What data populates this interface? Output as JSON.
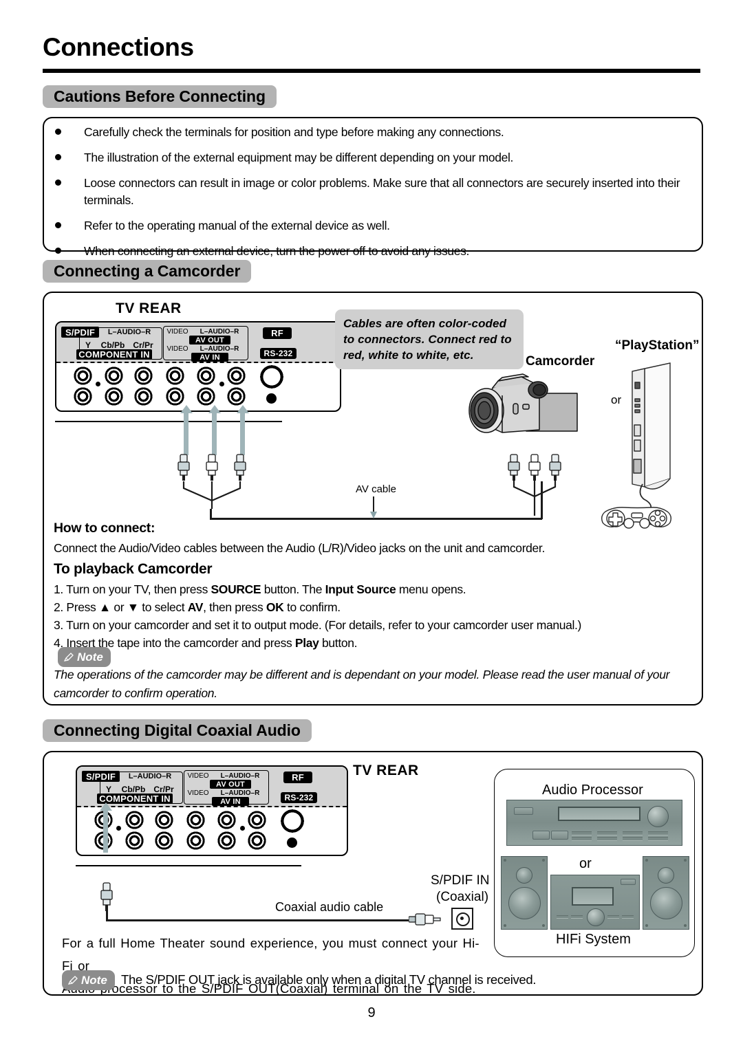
{
  "document": {
    "chapter_title": "Connections",
    "page_number": "9"
  },
  "sections": {
    "cautions": {
      "heading": "Cautions Before Connecting",
      "bullets": [
        "Carefully check the terminals for position and type before making any connections.",
        "The illustration of the external equipment may be different depending on your model.",
        "Loose connectors can result in image or color problems. Make sure that all connectors are securely inserted into their terminals.",
        "Refer to the operating manual of the external device as well.",
        "When connecting an external device, turn the power off to avoid any issues."
      ]
    },
    "camcorder": {
      "heading": "Connecting a Camcorder",
      "tv_rear_label": "TV REAR",
      "bubble_text": "Cables are often color-coded to connectors. Connect red to red, white to white, etc.",
      "camcorder_label": "Camcorder",
      "playstation_label": "“PlayStation”",
      "or_label": "or",
      "av_cable_label": "AV cable",
      "how_to_connect_heading": "How to connect:",
      "how_to_connect_text": "Connect the Audio/Video cables between the Audio (L/R)/Video jacks on the unit and camcorder.",
      "playback_heading": "To playback Camcorder",
      "steps": [
        {
          "num": "1.",
          "before": "Turn on your TV,  then press ",
          "b1": "SOURCE",
          "mid": " button. The ",
          "b2": "Input Source",
          "after": " menu opens."
        },
        {
          "num": "2.",
          "before": "Press ▲ or ▼ to select ",
          "b1": "AV",
          "mid": ", then press ",
          "b2": "OK",
          "after": " to confirm."
        },
        {
          "num": "3.",
          "before": "Turn on your camcorder and set it to output mode. (For details, refer to your camcorder user manual.)",
          "b1": "",
          "mid": "",
          "b2": "",
          "after": ""
        },
        {
          "num": "4.",
          "before": "Insert the tape into the camcorder and press ",
          "b1": "Play",
          "mid": " button.",
          "b2": "",
          "after": ""
        }
      ],
      "note_label": "Note",
      "note_text": "The operations of the camcorder may be different and is dependant on your model. Please read the user manual of your camcorder to confirm operation."
    },
    "coaxial": {
      "heading": "Connecting Digital Coaxial Audio",
      "tv_rear_label": "TV REAR",
      "audio_processor_label": "Audio  Processor",
      "or_label": "or",
      "hifi_label": "HIFi  System",
      "spdif_in_label": "S/PDIF IN",
      "coaxial_label": "(Coaxial)",
      "cable_label": "Coaxial audio cable",
      "body_line1": "For a full Home Theater sound experience, you must connect your Hi-Fi or",
      "body_line2": "Audio processor to the S/PDIF OUT(Coaxial) terminal on the TV side.",
      "note_label": "Note",
      "note_text": "The S/PDIF OUT jack is available only when a digital TV channel is received."
    }
  },
  "tv_panel_labels": {
    "spdif": "S/PDIF",
    "l_audio_r": "L–AUDIO–R",
    "y": "Y",
    "cb_pb": "Cb/Pb",
    "cr_pr": "Cr/Pr",
    "component_in": "COMPONENT IN",
    "video": "VIDEO",
    "av_out": "AV OUT",
    "av_in": "AV IN",
    "rf": "RF",
    "rs232": "RS-232"
  },
  "colors": {
    "pill_gray": "#b3b3b3",
    "panel_gray": "#d4d4d4",
    "bubble_gray": "#cfcfcf",
    "note_gray": "#8c8c8c",
    "arrow_teal": "#9fb4b8",
    "gear_green": "#7d8d8a"
  }
}
